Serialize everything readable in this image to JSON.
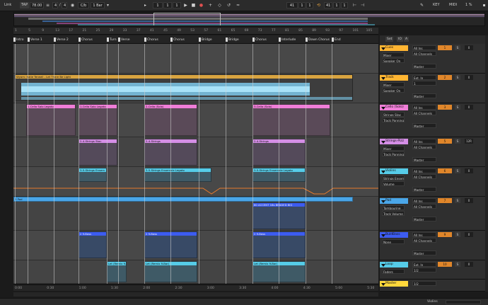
{
  "transport": {
    "link": "Link",
    "tap": "TAP",
    "tempo": "78.00",
    "sig_num": "4",
    "sig_den": "4",
    "metro": "C/b",
    "quant": "1 Bar",
    "pos_bar": "1",
    "pos_beat": "1",
    "pos_sixteenth": "1",
    "loop_start": "41",
    "loop_mid": "1",
    "loop_end": "1",
    "key": "KEY",
    "midi": "MIDI",
    "cpu": "1 %"
  },
  "overview": {
    "colors": [
      "#e4b8e6",
      "#c8a0f0",
      "#f0f0f0",
      "#4488dd",
      "#e45cc8",
      "#55c8e6"
    ]
  },
  "ruler": {
    "bars": [
      "1",
      "5",
      "9",
      "13",
      "17",
      "21",
      "25",
      "29",
      "33",
      "37",
      "41",
      "45",
      "49",
      "53",
      "57",
      "61",
      "65",
      "69",
      "73",
      "77",
      "81",
      "85",
      "89",
      "93",
      "97",
      "101",
      "105"
    ]
  },
  "locators": [
    {
      "label": "Intro"
    },
    {
      "label": "Verse 1"
    },
    {
      "label": "Verse 2"
    },
    {
      "label": "Chorus"
    },
    {
      "label": "Turn"
    },
    {
      "label": "Verse"
    },
    {
      "label": "Chorus"
    },
    {
      "label": "Chorus"
    },
    {
      "label": "Bridge"
    },
    {
      "label": "Bridge"
    },
    {
      "label": "Chorus"
    },
    {
      "label": "Interlude"
    },
    {
      "label": "Down Chorus"
    },
    {
      "label": "End"
    }
  ],
  "clips": {
    "audio_title": "Wyam: Katie Terwell - Let There Be Light",
    "cello_a": "1-Cello Solo Legato",
    "cello_b": "2-Cello (Solo)",
    "cello_c": "3-Cello (Solo)",
    "strings_a": "2-4-Strings Stac",
    "strings_b": "2-4-Strings",
    "violins_a": "3-5-Strings Ensemble Legato",
    "violins_b": "3-5-Strings Ensem",
    "pad": "3 Pad",
    "tamb": "80 ACCENT 16s BEADED BIG",
    "bass": "2 9-Bass",
    "loop": "Let (Remix 9-Bar)"
  },
  "timeaxis": [
    "0:00",
    "0:30",
    "1:00",
    "1:30",
    "2:00",
    "2:30",
    "3:00",
    "3:30",
    "4:00",
    "4:30",
    "5:00",
    "5:30"
  ],
  "tracks": [
    {
      "name": "Cues",
      "color": "#ffb532",
      "in": "All Ins",
      "route": "Mixer",
      "out": "All Channels",
      "speaker": "Speaker On",
      "master": "Master",
      "num": "1",
      "vol": "0"
    },
    {
      "name": "Track",
      "color": "#ffb532",
      "in": "Ext. In",
      "route": "Mixer",
      "out": "1",
      "speaker": "Speaker On",
      "master": "Master",
      "num": "2",
      "vol": "0"
    },
    {
      "name": "Cello (Solo)",
      "color": "#f07ed8",
      "in": "All Ins",
      "route": "Strings Stac",
      "out": "All Channels",
      "speaker": "Track Panning",
      "master": "Master",
      "num": "3",
      "vol": "0"
    },
    {
      "name": "Strings-Pizz",
      "color": "#d58ee6",
      "in": "All Ins",
      "route": "Mixer",
      "out": "All Channels",
      "speaker": "Track Panning",
      "master": "Master",
      "num": "5",
      "vol": "12R"
    },
    {
      "name": "Violins",
      "color": "#56cce8",
      "in": "All Ins",
      "route": "Strings Ensem",
      "out": "All Channels",
      "speaker": "Volume",
      "master": "Master",
      "num": "6",
      "vol": "0"
    },
    {
      "name": "Pad",
      "color": "#4aa6e8",
      "in": "All Ins",
      "route": "Tambourine",
      "out": "All Channels",
      "speaker": "Track Volume",
      "master": "Master",
      "num": "7",
      "vol": "0"
    },
    {
      "name": "BuldBass",
      "color": "#3d5cf0",
      "in": "All Ins",
      "route": "None",
      "out": "All Channels",
      "speaker": "",
      "master": "Master",
      "num": "9",
      "vol": "0"
    },
    {
      "name": "Loop",
      "color": "#56cce8",
      "in": "Ext. In",
      "route": "Faders",
      "out": "1/2",
      "speaker": "",
      "master": "Master",
      "num": "10",
      "vol": "0"
    },
    {
      "name": "Master",
      "color": "#ffd83c",
      "in": "1/2",
      "route": "",
      "out": "",
      "speaker": "",
      "master": "",
      "num": "",
      "vol": ""
    }
  ],
  "mixer_header": {
    "set": "Set",
    "io": "IO",
    "fx": "A"
  },
  "status": {
    "track_name": "Violins"
  }
}
